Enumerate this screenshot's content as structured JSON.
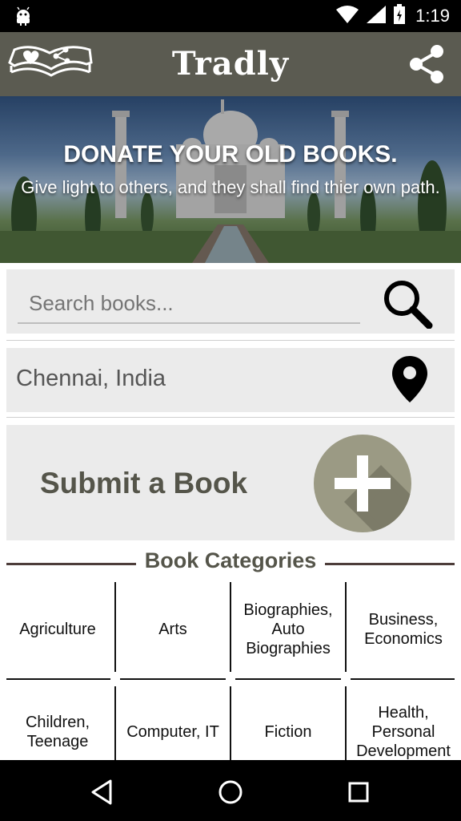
{
  "status_bar": {
    "time": "1:19",
    "icons": [
      "android-icon",
      "wifi-icon",
      "signal-icon",
      "battery-icon"
    ]
  },
  "app_bar": {
    "title": "Tradly",
    "logo_icon": "book-heart-share-logo",
    "share_icon": "share-icon",
    "background": "#5b5b51"
  },
  "hero": {
    "headline": "DONATE YOUR OLD BOOKS.",
    "subtitle": "Give light to others, and they shall find thier own path."
  },
  "search": {
    "placeholder": "Search books...",
    "value": "",
    "icon": "search-icon"
  },
  "location": {
    "text": "Chennai, India",
    "icon": "map-pin-icon"
  },
  "submit": {
    "label": "Submit a Book",
    "icon": "plus-icon",
    "accent": "#9b9a84"
  },
  "categories": {
    "title": "Book Categories",
    "rows": [
      [
        "Agriculture",
        "Arts",
        "Biographies, Auto Biographies",
        "Business, Economics"
      ],
      [
        "Children, Teenage",
        "Computer, IT",
        "Fiction",
        "Health, Personal Development"
      ]
    ]
  },
  "nav_bar": {
    "icons": [
      "back-icon",
      "home-icon",
      "recents-icon"
    ]
  }
}
